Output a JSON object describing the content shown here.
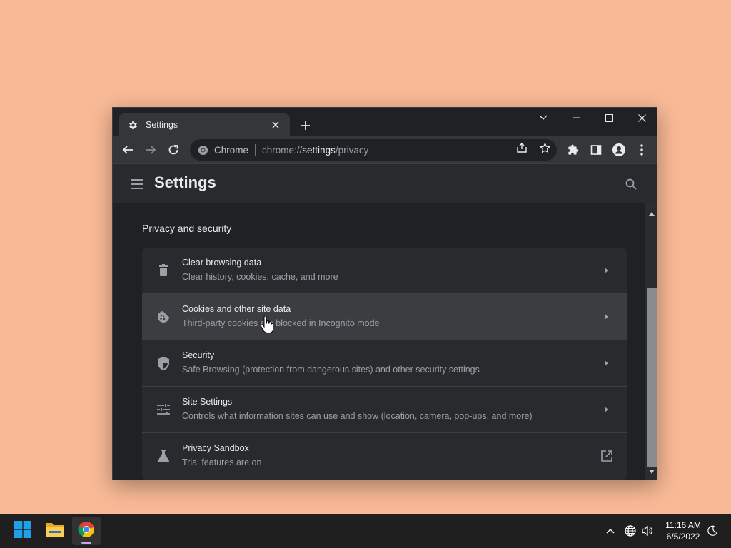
{
  "colors": {
    "desktop": "#f8b996",
    "window_bg": "#202124",
    "toolbar_bg": "#35363a",
    "card_bg": "#292a2d",
    "text_primary": "#e8eaed",
    "text_secondary": "#9aa0a6",
    "taskbar_bg": "#1f1f1f"
  },
  "browser": {
    "tab": {
      "title": "Settings",
      "icon": "gear-icon"
    },
    "omnibox": {
      "chip": "Chrome",
      "url_scheme": "chrome://",
      "url_host": "settings",
      "url_path": "/privacy"
    }
  },
  "settings": {
    "title": "Settings",
    "section_title": "Privacy and security",
    "items": [
      {
        "label": "Clear browsing data",
        "sub": "Clear history, cookies, cache, and more",
        "icon": "trash-icon",
        "trailing": "arrow"
      },
      {
        "label": "Cookies and other site data",
        "sub": "Third-party cookies are blocked in Incognito mode",
        "icon": "cookie-icon",
        "trailing": "arrow",
        "hovered": true
      },
      {
        "label": "Security",
        "sub": "Safe Browsing (protection from dangerous sites) and other security settings",
        "icon": "shield-icon",
        "trailing": "arrow"
      },
      {
        "label": "Site Settings",
        "sub": "Controls what information sites can use and show (location, camera, pop-ups, and more)",
        "icon": "sliders-icon",
        "trailing": "arrow"
      },
      {
        "label": "Privacy Sandbox",
        "sub": "Trial features are on",
        "icon": "flask-icon",
        "trailing": "external-link"
      }
    ]
  },
  "taskbar": {
    "apps": [
      {
        "name": "Start",
        "icon": "windows-logo-icon"
      },
      {
        "name": "File Explorer",
        "icon": "folder-icon"
      },
      {
        "name": "Google Chrome",
        "icon": "chrome-icon",
        "active": true
      }
    ],
    "clock": {
      "time": "11:16 AM",
      "date": "6/5/2022"
    }
  }
}
